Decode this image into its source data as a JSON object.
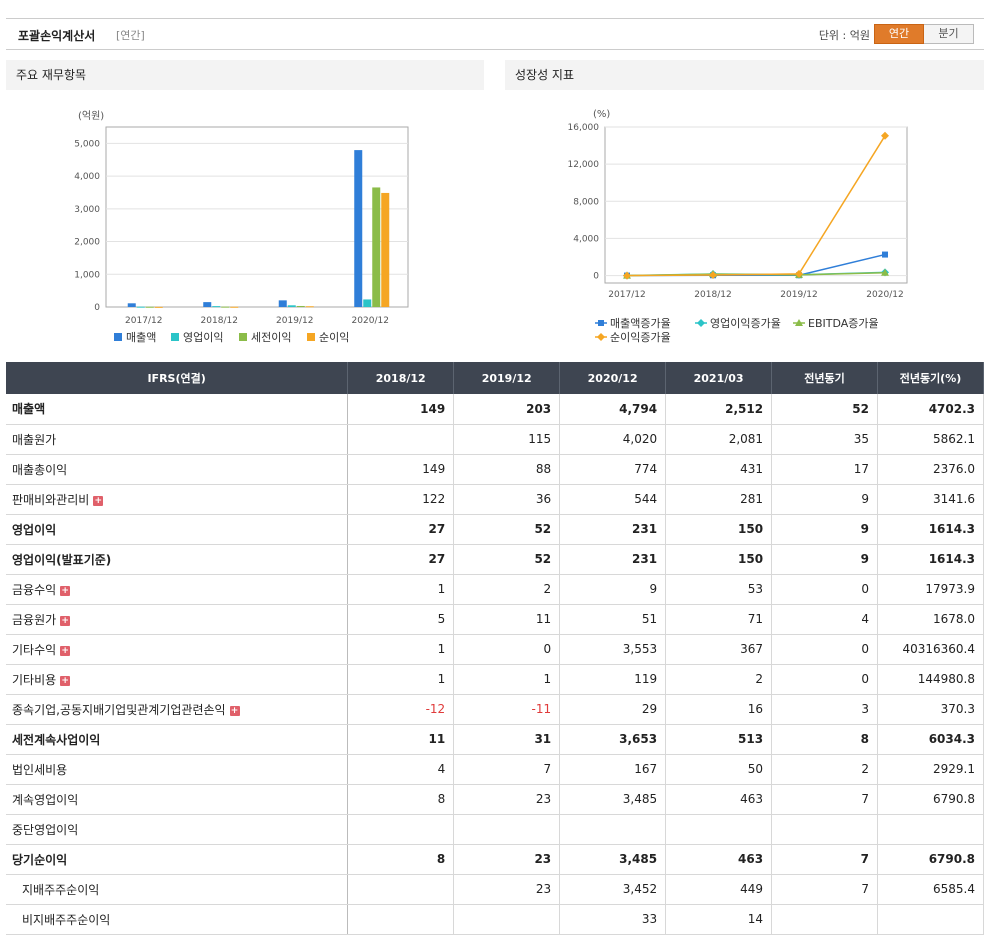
{
  "header": {
    "title": "포괄손익계산서",
    "period_type": "[연간]",
    "unit_label": "단위 : 억원",
    "tabs": [
      "연간",
      "분기"
    ]
  },
  "panels": {
    "left_title": "주요 재무항목",
    "right_title": "성장성 지표"
  },
  "chart_data": [
    {
      "type": "bar",
      "ylabel": "(억원)",
      "categories": [
        "2017/12",
        "2018/12",
        "2019/12",
        "2020/12"
      ],
      "ylim": [
        0,
        5500
      ],
      "yticks": [
        0,
        1000,
        2000,
        3000,
        4000,
        5000
      ],
      "ytick_labels": [
        "0",
        "1,000",
        "2,000",
        "3,000",
        "4,000",
        "5,000"
      ],
      "legend": "bottom",
      "series": [
        {
          "name": "매출액",
          "color": "#2f7ed8",
          "values": [
            113,
            149,
            203,
            4794
          ]
        },
        {
          "name": "영업이익",
          "color": "#2bc4c8",
          "values": [
            10,
            27,
            52,
            231
          ]
        },
        {
          "name": "세전이익",
          "color": "#8bbc49",
          "values": [
            8,
            11,
            31,
            3653
          ]
        },
        {
          "name": "순이익",
          "color": "#f5a623",
          "values": [
            5,
            8,
            23,
            3485
          ]
        }
      ]
    },
    {
      "type": "line",
      "ylabel": "(%)",
      "categories": [
        "2017/12",
        "2018/12",
        "2019/12",
        "2020/12"
      ],
      "ylim": [
        -800,
        16000
      ],
      "yticks": [
        0,
        4000,
        8000,
        12000,
        16000
      ],
      "ytick_labels": [
        "0",
        "4,000",
        "8,000",
        "12,000",
        "16,000"
      ],
      "legend": "bottom",
      "series": [
        {
          "name": "매출액증가율",
          "color": "#2f7ed8",
          "marker": "square",
          "values": [
            0,
            32,
            36,
            2262
          ]
        },
        {
          "name": "영업이익증가율",
          "color": "#2bc4c8",
          "marker": "diamond",
          "values": [
            0,
            170,
            93,
            344
          ]
        },
        {
          "name": "EBITDA증가율",
          "color": "#8bbc49",
          "marker": "triangle",
          "values": [
            0,
            150,
            80,
            300
          ]
        },
        {
          "name": "순이익증가율",
          "color": "#f5a623",
          "marker": "diamond",
          "values": [
            0,
            60,
            188,
            15052
          ]
        }
      ]
    }
  ],
  "table": {
    "headers": [
      "IFRS(연결)",
      "2018/12",
      "2019/12",
      "2020/12",
      "2021/03",
      "전년동기",
      "전년동기(%)"
    ],
    "rows": [
      {
        "label": "매출액",
        "bold": true,
        "values": [
          "149",
          "203",
          "4,794",
          "2,512",
          "52",
          "4702.3"
        ]
      },
      {
        "label": "매출원가",
        "values": [
          "",
          "115",
          "4,020",
          "2,081",
          "35",
          "5862.1"
        ]
      },
      {
        "label": "매출총이익",
        "values": [
          "149",
          "88",
          "774",
          "431",
          "17",
          "2376.0"
        ]
      },
      {
        "label": "판매비와관리비",
        "expand": true,
        "values": [
          "122",
          "36",
          "544",
          "281",
          "9",
          "3141.6"
        ]
      },
      {
        "label": "영업이익",
        "bold": true,
        "values": [
          "27",
          "52",
          "231",
          "150",
          "9",
          "1614.3"
        ]
      },
      {
        "label": "영업이익(발표기준)",
        "bold": true,
        "values": [
          "27",
          "52",
          "231",
          "150",
          "9",
          "1614.3"
        ]
      },
      {
        "label": "금융수익",
        "expand": true,
        "values": [
          "1",
          "2",
          "9",
          "53",
          "0",
          "17973.9"
        ]
      },
      {
        "label": "금융원가",
        "expand": true,
        "values": [
          "5",
          "11",
          "51",
          "71",
          "4",
          "1678.0"
        ]
      },
      {
        "label": "기타수익",
        "expand": true,
        "values": [
          "1",
          "0",
          "3,553",
          "367",
          "0",
          "40316360.4"
        ]
      },
      {
        "label": "기타비용",
        "expand": true,
        "values": [
          "1",
          "1",
          "119",
          "2",
          "0",
          "144980.8"
        ]
      },
      {
        "label": "종속기업,공동지배기업및관계기업관련손익",
        "expand": true,
        "values": [
          "-12",
          "-11",
          "29",
          "16",
          "3",
          "370.3"
        ]
      },
      {
        "label": "세전계속사업이익",
        "bold": true,
        "values": [
          "11",
          "31",
          "3,653",
          "513",
          "8",
          "6034.3"
        ]
      },
      {
        "label": "법인세비용",
        "values": [
          "4",
          "7",
          "167",
          "50",
          "2",
          "2929.1"
        ]
      },
      {
        "label": "계속영업이익",
        "values": [
          "8",
          "23",
          "3,485",
          "463",
          "7",
          "6790.8"
        ]
      },
      {
        "label": "중단영업이익",
        "values": [
          "",
          "",
          "",
          "",
          "",
          ""
        ]
      },
      {
        "label": "당기순이익",
        "bold": true,
        "values": [
          "8",
          "23",
          "3,485",
          "463",
          "7",
          "6790.8"
        ]
      },
      {
        "label": "지배주주순이익",
        "indent": true,
        "values": [
          "",
          "23",
          "3,452",
          "449",
          "7",
          "6585.4"
        ]
      },
      {
        "label": "비지배주주순이익",
        "indent": true,
        "values": [
          "",
          "",
          "33",
          "14",
          "",
          ""
        ]
      }
    ]
  }
}
